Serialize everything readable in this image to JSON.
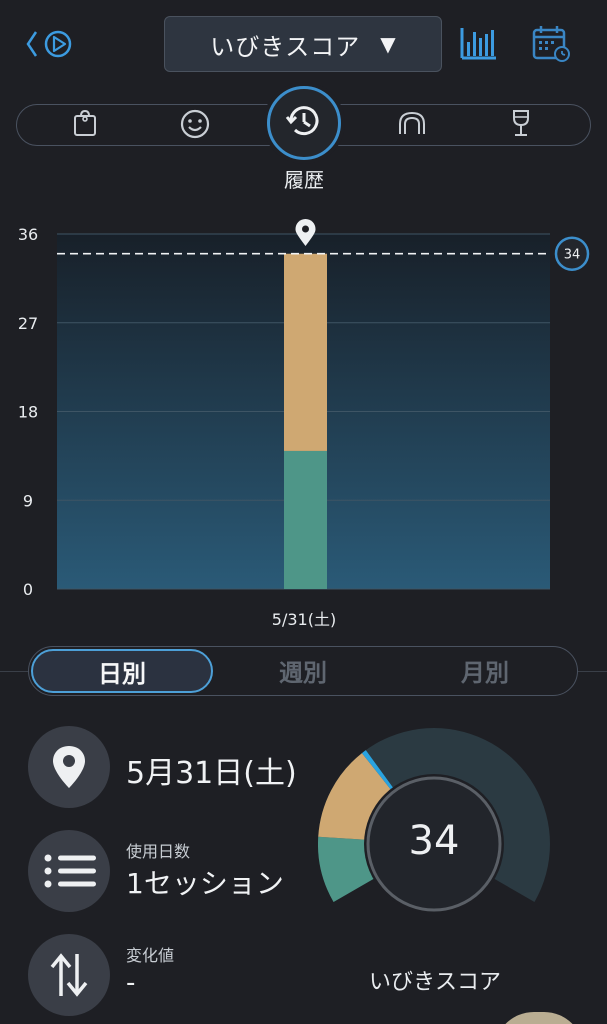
{
  "header": {
    "score_selector": {
      "label": "いびきスコア",
      "caret": "▼"
    },
    "icons": [
      "back-play-icon",
      "bar-chart-icon",
      "calendar-icon"
    ]
  },
  "category_bar": {
    "items": [
      "bag-icon",
      "smile-icon",
      "history-icon",
      "arch-icon",
      "wine-glass-icon"
    ],
    "active_label": "履歴"
  },
  "chart_data": {
    "type": "bar",
    "categories": [
      "5/31(土)"
    ],
    "series": [
      {
        "values": [
          14
        ]
      },
      {
        "values": [
          20
        ]
      }
    ],
    "ylim": [
      0,
      36
    ],
    "yticks": [
      0,
      9,
      18,
      27,
      36
    ],
    "reference_line": 34,
    "reference_label": "34",
    "grid": true,
    "colors": {
      "lower": "#4e9688",
      "upper": "#cfa872"
    }
  },
  "period_tabs": [
    {
      "label": "日別",
      "active": true
    },
    {
      "label": "週別",
      "active": false
    },
    {
      "label": "月別",
      "active": false
    }
  ],
  "info": {
    "date": "5月31日(土)",
    "usage_label": "使用日数",
    "usage_value": "1セッション",
    "change_label": "変化値",
    "change_value": "-"
  },
  "gauge": {
    "value": "34",
    "title": "いびきスコア",
    "segments": [
      {
        "name": "lower",
        "amount": 14,
        "color": "#4e9688"
      },
      {
        "name": "upper",
        "amount": 20,
        "color": "#cfa872"
      },
      {
        "name": "marker",
        "amount": 1,
        "color": "#29a3e0"
      }
    ],
    "max": 100
  }
}
